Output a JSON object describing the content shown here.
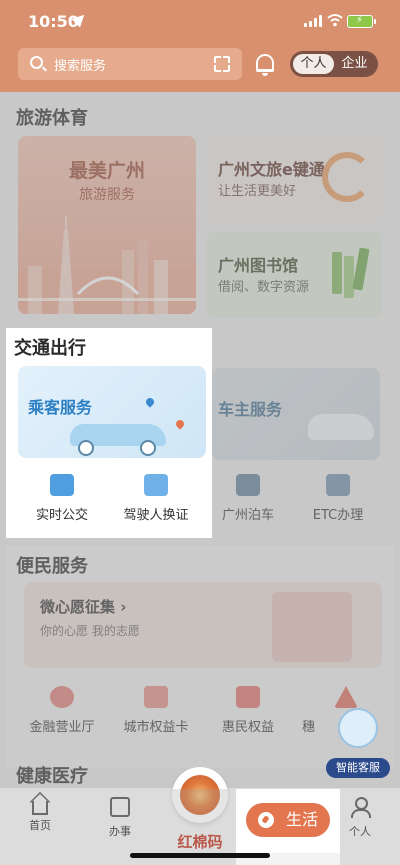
{
  "status_bar": {
    "time": "10:50"
  },
  "header": {
    "search_placeholder": "搜索服务",
    "toggle": {
      "personal": "个人",
      "enterprise": "企业"
    }
  },
  "sections": {
    "tourism": {
      "title": "旅游体育",
      "card_main": {
        "title": "最美广州",
        "subtitle": "旅游服务"
      },
      "card_culture": {
        "title": "广州文旅e键通",
        "subtitle": "让生活更美好"
      },
      "card_library": {
        "title": "广州图书馆",
        "subtitle": "借阅、数字资源"
      }
    },
    "traffic": {
      "title": "交通出行",
      "passenger_card": "乘客服务",
      "owner_card": "车主服务",
      "items": [
        {
          "label": "实时公交",
          "icon": "bus-icon"
        },
        {
          "label": "驾驶人换证",
          "icon": "license-icon"
        },
        {
          "label": "广州泊车",
          "icon": "parking-car-icon"
        },
        {
          "label": "ETC办理",
          "icon": "etc-icon"
        }
      ]
    },
    "civil": {
      "title": "便民服务",
      "wish_card": {
        "title": "微心愿征集",
        "arrow": "›",
        "subtitle": "你的心愿 我的志愿"
      },
      "items": [
        {
          "label": "金融营业厅",
          "icon": "finance-icon"
        },
        {
          "label": "城市权益卡",
          "icon": "card-icon"
        },
        {
          "label": "惠民权益",
          "icon": "benefit-icon"
        },
        {
          "label": "穗",
          "icon": "triangle-logo-icon"
        }
      ]
    },
    "health": {
      "title": "健康医疗"
    }
  },
  "assistant": {
    "label": "智能客服"
  },
  "bottom_nav": {
    "home": "首页",
    "tasks": "办事",
    "center": "红棉码",
    "life": "生活",
    "me": "个人"
  },
  "colors": {
    "header": "#d8906e",
    "accent": "#e4764f",
    "passenger_blue": "#2d7fc4"
  }
}
